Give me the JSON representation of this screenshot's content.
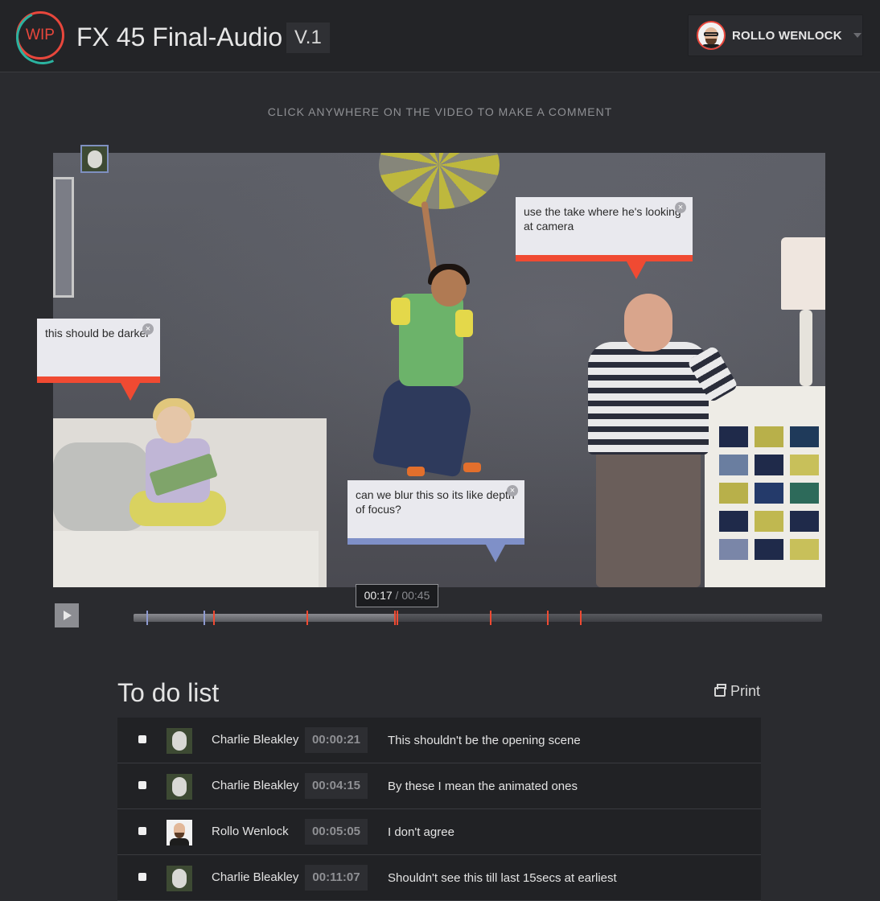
{
  "header": {
    "logo_text": "WIP",
    "project_title": "FX 45 Final-Audio",
    "version": "V.1",
    "user_name": "ROLLO WENLOCK"
  },
  "instruction": "CLICK ANYWHERE ON THE VIDEO TO MAKE A COMMENT",
  "comments": [
    {
      "text": "this should be darker",
      "color": "#f04a32"
    },
    {
      "text": "use the take where he's looking at camera",
      "color": "#f04a32"
    },
    {
      "text": "can we blur this so its like depth of focus?",
      "color": "#7f90c8"
    }
  ],
  "player": {
    "current_time": "00:17",
    "separator": " / ",
    "total_time": "00:45",
    "progress": 0.38,
    "markers": [
      {
        "at": 0.019,
        "color": "#8e9ad0"
      },
      {
        "at": 0.102,
        "color": "#8e9ad0"
      },
      {
        "at": 0.116,
        "color": "#f04a32"
      },
      {
        "at": 0.251,
        "color": "#f04a32"
      },
      {
        "at": 0.379,
        "color": "#f04a32"
      },
      {
        "at": 0.382,
        "color": "#f04a32"
      },
      {
        "at": 0.518,
        "color": "#f04a32"
      },
      {
        "at": 0.6,
        "color": "#f04a32"
      },
      {
        "at": 0.648,
        "color": "#f04a32"
      }
    ]
  },
  "todo": {
    "title": "To do list",
    "print_label": "Print",
    "rows": [
      {
        "name": "Charlie Bleakley",
        "time": "00:00:21",
        "text": "This shouldn't be the opening scene",
        "avatar": "charlie"
      },
      {
        "name": "Charlie Bleakley",
        "time": "00:04:15",
        "text": "By these I mean the animated ones",
        "avatar": "charlie"
      },
      {
        "name": "Rollo Wenlock",
        "time": "00:05:05",
        "text": "I don't agree",
        "avatar": "rollo"
      },
      {
        "name": "Charlie Bleakley",
        "time": "00:11:07",
        "text": "Shouldn't see this till last 15secs at earliest",
        "avatar": "charlie"
      }
    ]
  }
}
